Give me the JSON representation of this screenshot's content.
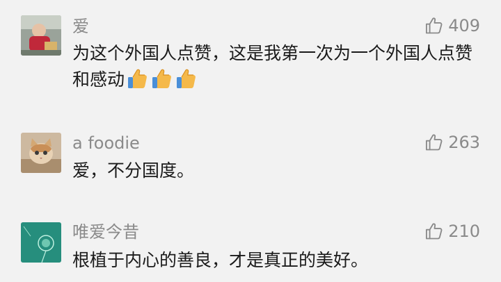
{
  "comments": [
    {
      "nickname": "爱",
      "likes": "409",
      "text": "为这个外国人点赞，这是我第一次为一个外国人点赞和感动",
      "emojis": [
        "thumbs-up-emoji",
        "thumbs-up-emoji",
        "thumbs-up-emoji"
      ],
      "avatar": "avatar-child-photo"
    },
    {
      "nickname": "a foodie",
      "likes": "263",
      "text": "爱，不分国度。",
      "avatar": "avatar-cat-photo"
    },
    {
      "nickname": "唯爱今昔",
      "likes": "210",
      "text": "根植于内心的善良，才是真正的美好。",
      "avatar": "avatar-dandelion-photo"
    }
  ],
  "icons": {
    "like": "thumbs-up-outline-icon"
  },
  "colors": {
    "background": "#f2f2f2",
    "nickname": "#8a8a8a",
    "text": "#1a1a1a",
    "icon": "#8a8a8a"
  }
}
